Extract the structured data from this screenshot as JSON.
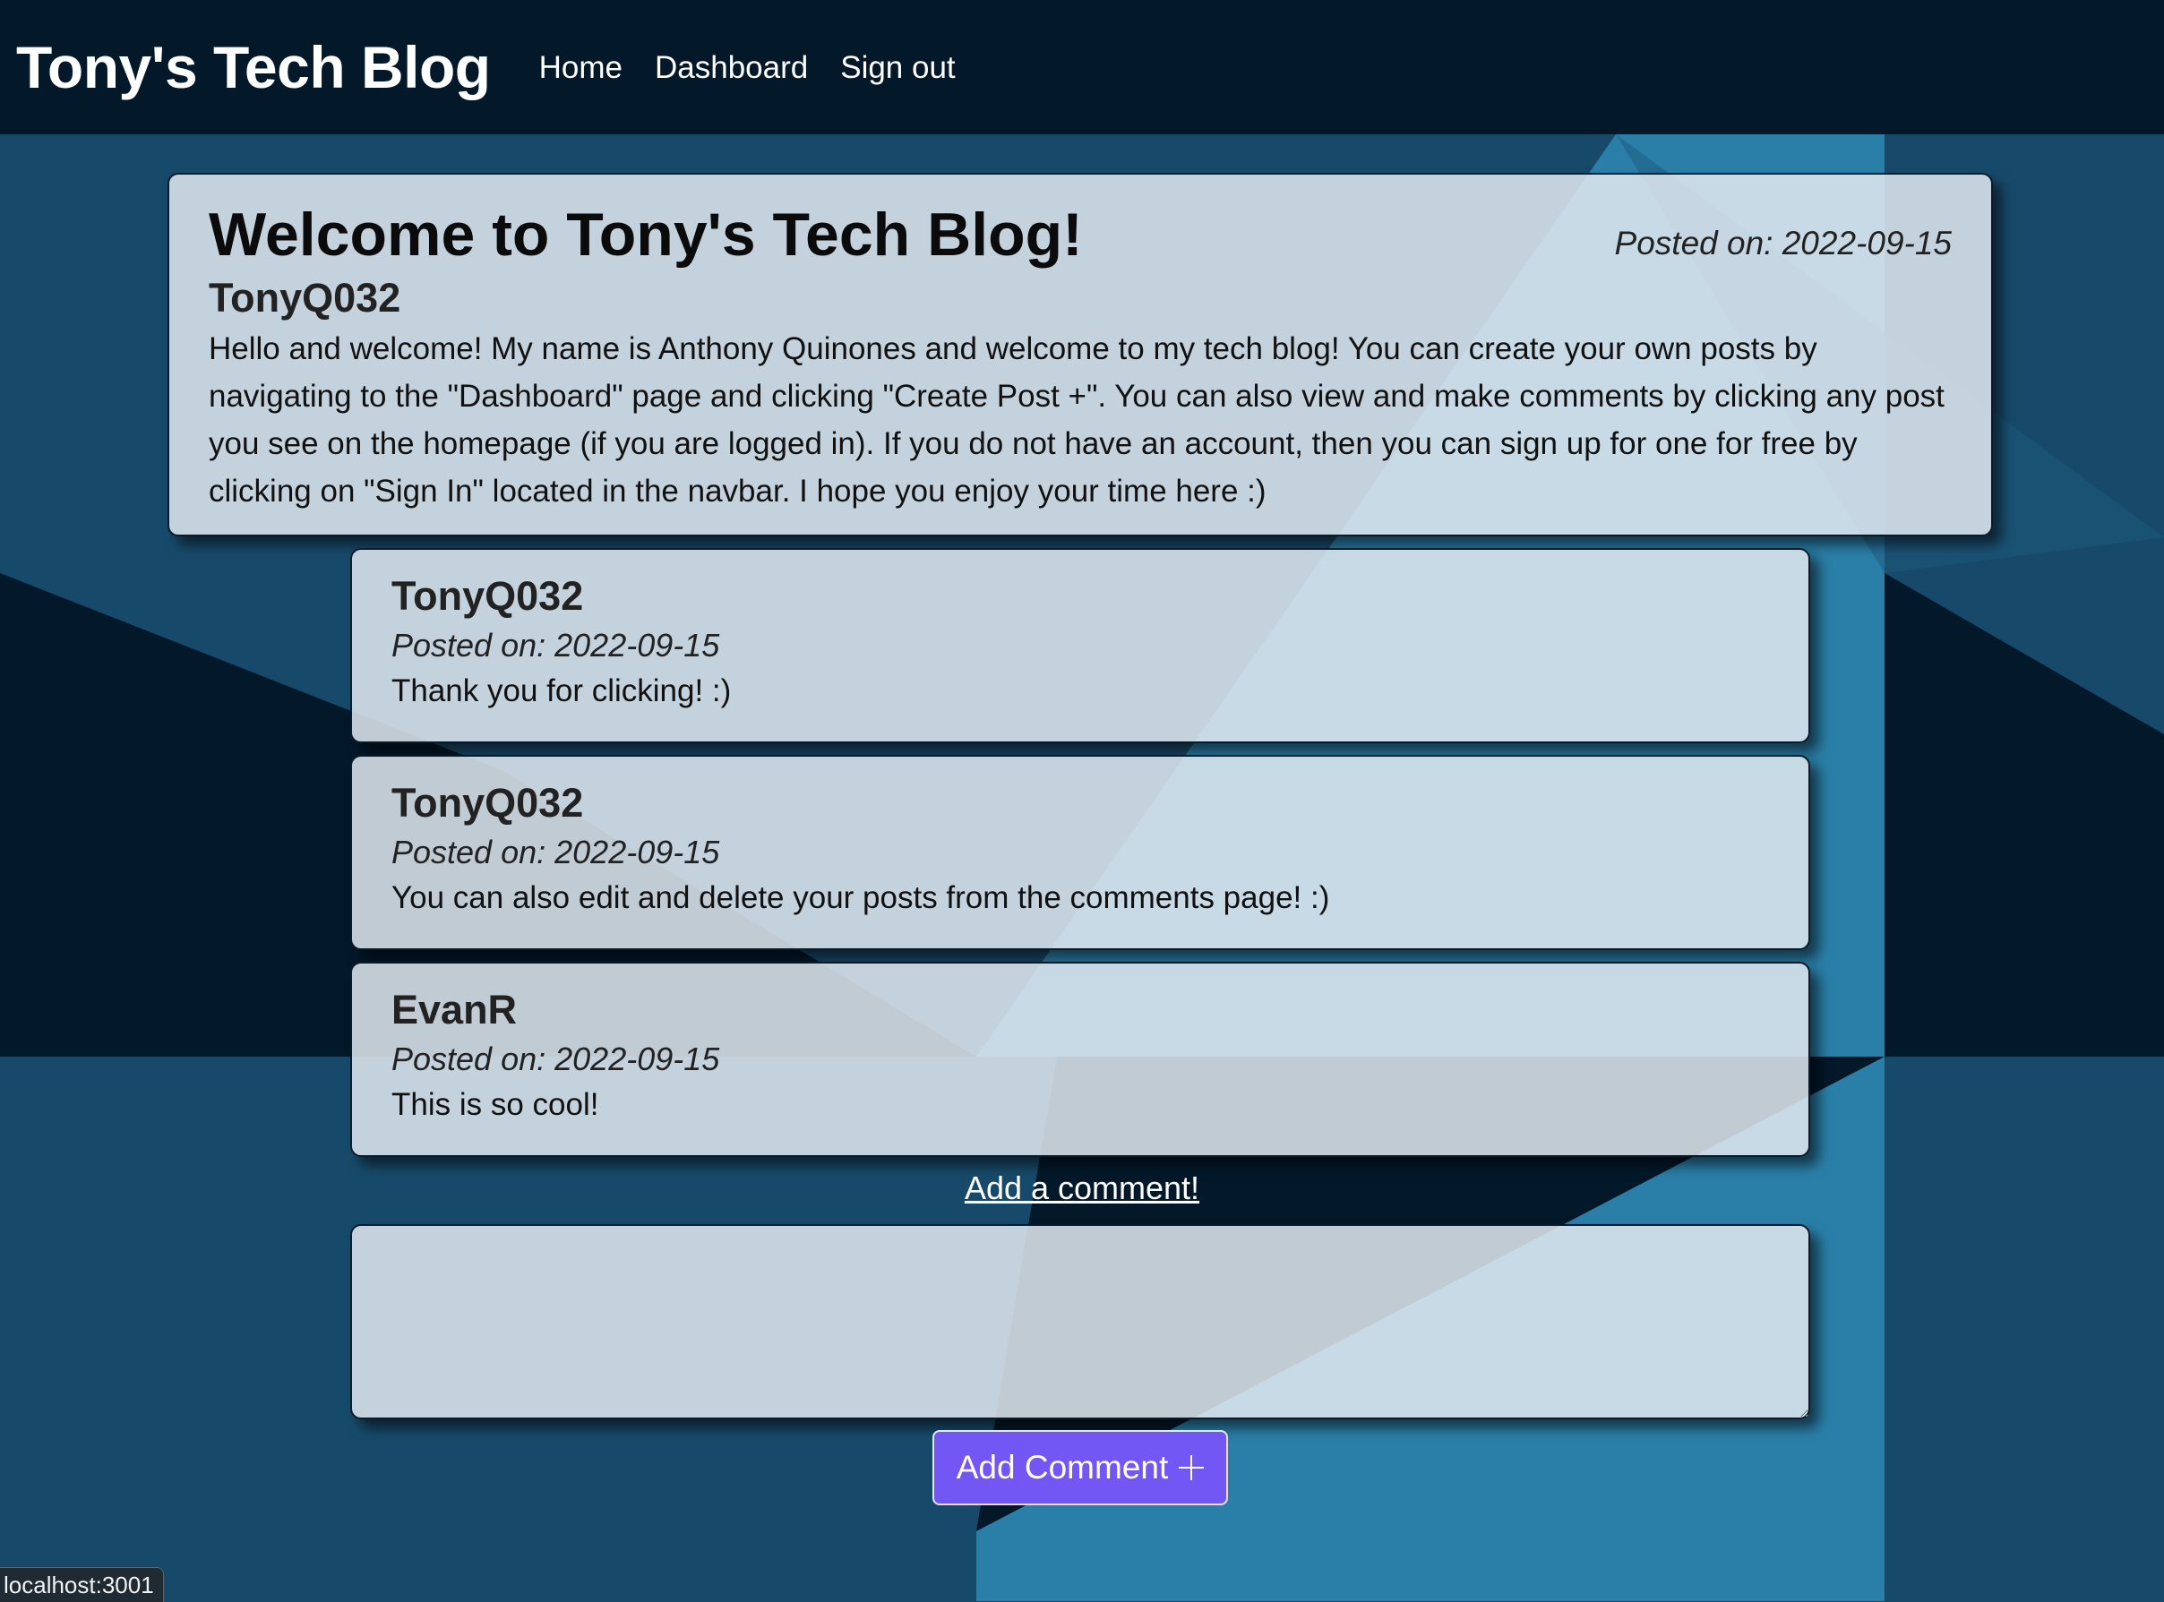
{
  "navbar": {
    "brand": "Tony's Tech Blog",
    "links": [
      "Home",
      "Dashboard",
      "Sign out"
    ]
  },
  "post": {
    "title": "Welcome to Tony's Tech Blog!",
    "date": "Posted on: 2022-09-15",
    "author": "TonyQ032",
    "body": "Hello and welcome! My name is Anthony Quinones and welcome to my tech blog! You can create your own posts by navigating to the \"Dashboard\" page and clicking \"Create Post +\". You can also view and make comments by clicking any post you see on the homepage (if you are logged in). If you do not have an account, then you can sign up for one for free by clicking on \"Sign In\" located in the navbar. I hope you enjoy your time here :)"
  },
  "comments": [
    {
      "author": "TonyQ032",
      "date": "Posted on: 2022-09-15",
      "text": "Thank you for clicking! :)"
    },
    {
      "author": "TonyQ032",
      "date": "Posted on: 2022-09-15",
      "text": "You can also edit and delete your posts from the comments page! :)"
    },
    {
      "author": "EvanR",
      "date": "Posted on: 2022-09-15",
      "text": "This is so cool!"
    }
  ],
  "comment_form": {
    "link_label": "Add a comment!",
    "textarea_value": "",
    "submit_label": "Add Comment"
  },
  "status_bar": {
    "url": "localhost:3001"
  },
  "colors": {
    "navbar_bg": "#03192a",
    "accent_button": "#7257f5",
    "background_dark": "#03192a",
    "background_mid": "#174a6a",
    "background_light": "#2a7fa8"
  },
  "icons": {
    "submit": "plus-icon"
  }
}
